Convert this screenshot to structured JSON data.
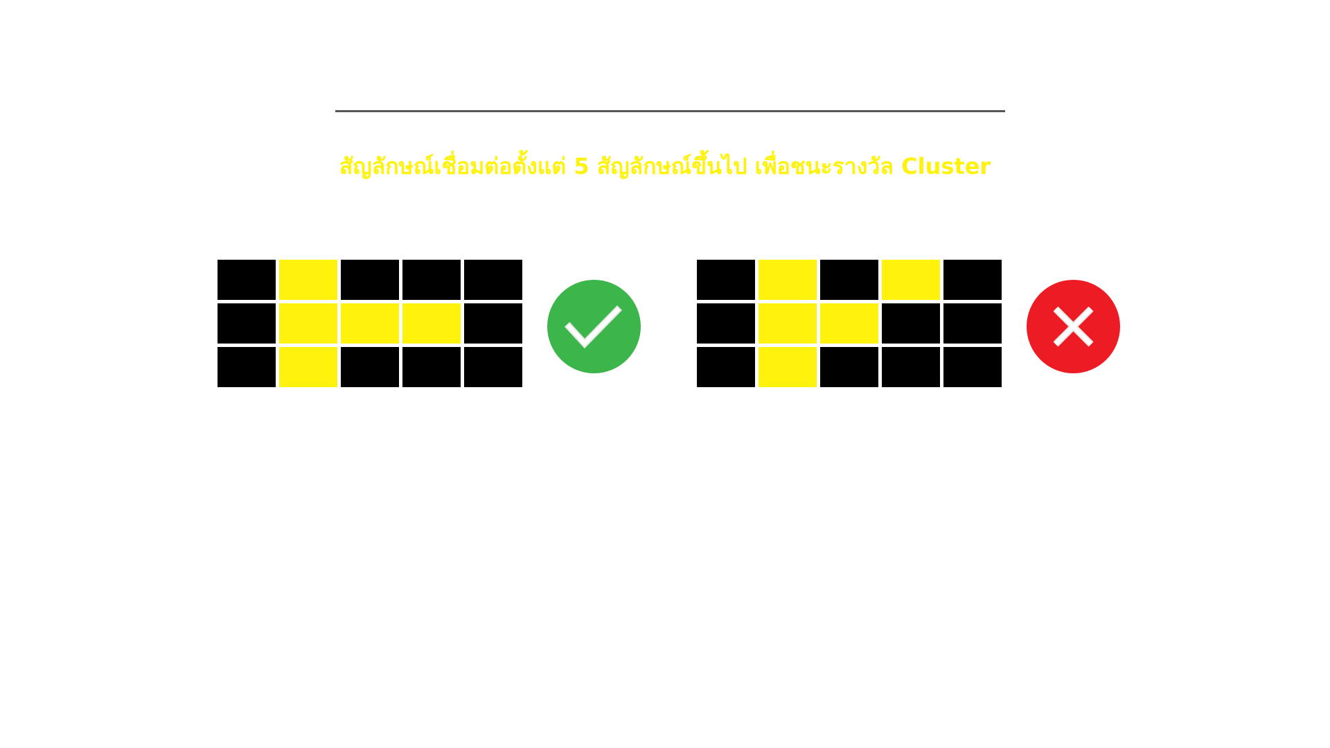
{
  "headline": "สัญลักษณ์เชื่อมต่อตั้งแต่ 5 สัญลักษณ์ขึ้นไป เพื่อชนะรางวัล Cluster",
  "colors": {
    "headline": "#fff20d",
    "symbol": "#fff20d",
    "empty": "#000000",
    "divider": "#555555",
    "valid": "#3cb54a",
    "invalid": "#ed1c24"
  },
  "examples": [
    {
      "result": "valid",
      "icon": "check-icon",
      "grid": [
        [
          0,
          1,
          0,
          0,
          0
        ],
        [
          0,
          1,
          1,
          1,
          0
        ],
        [
          0,
          1,
          0,
          0,
          0
        ]
      ]
    },
    {
      "result": "invalid",
      "icon": "cross-icon",
      "grid": [
        [
          0,
          1,
          0,
          1,
          0
        ],
        [
          0,
          1,
          1,
          0,
          0
        ],
        [
          0,
          1,
          0,
          0,
          0
        ]
      ]
    }
  ]
}
